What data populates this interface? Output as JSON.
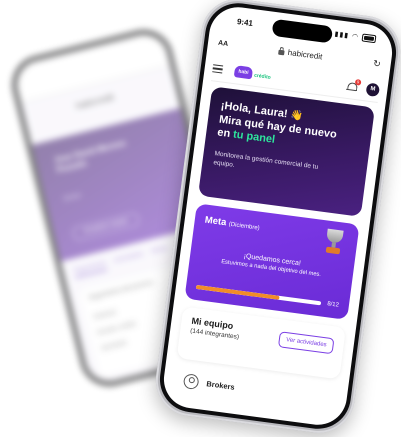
{
  "back_phone": {
    "url": "habicredit",
    "hero_title": "Jose David Moreno Pozuelo",
    "hero_sub": "Broker",
    "hero_button": "Actualizar equipo",
    "tabs": [
      "Seguimiento",
      "Actividades",
      "Metas"
    ],
    "card_title": "Seguimiento del proceso",
    "items": [
      "Solicitud",
      "Estudio crédito",
      "Aprobado"
    ]
  },
  "status_bar": {
    "time": "9:41"
  },
  "browser": {
    "text_size_label": "AA",
    "url": "habicredit"
  },
  "header": {
    "logo_mark": "habi",
    "logo_text": "crédito",
    "notification_count": "9",
    "avatar_initial": "M"
  },
  "hero": {
    "line1": "¡Hola, Laura!",
    "wave_emoji": "👋",
    "line2": "Mira qué hay de nuevo",
    "line3_prefix": "en ",
    "line3_highlight": "tu panel",
    "subtitle": "Monitorea la gestión comercial de tu equipo."
  },
  "goal": {
    "title": "Meta",
    "period": "(Diciembre)",
    "message": "¡Quedamos cerca!",
    "detail": "Estuvimos a nada del objetivo del mes.",
    "progress_fraction": 0.667,
    "progress_label": "8/12"
  },
  "team": {
    "title": "Mi equipo",
    "subtitle": "(144 integrantes)",
    "button_label": "Ver actividades"
  },
  "brokers": {
    "label": "Brokers"
  },
  "colors": {
    "brand_purple": "#7b3fe4",
    "hero_dark": "#2a1450",
    "accent_green": "#2ee59d",
    "progress_orange": "#f28c28"
  }
}
